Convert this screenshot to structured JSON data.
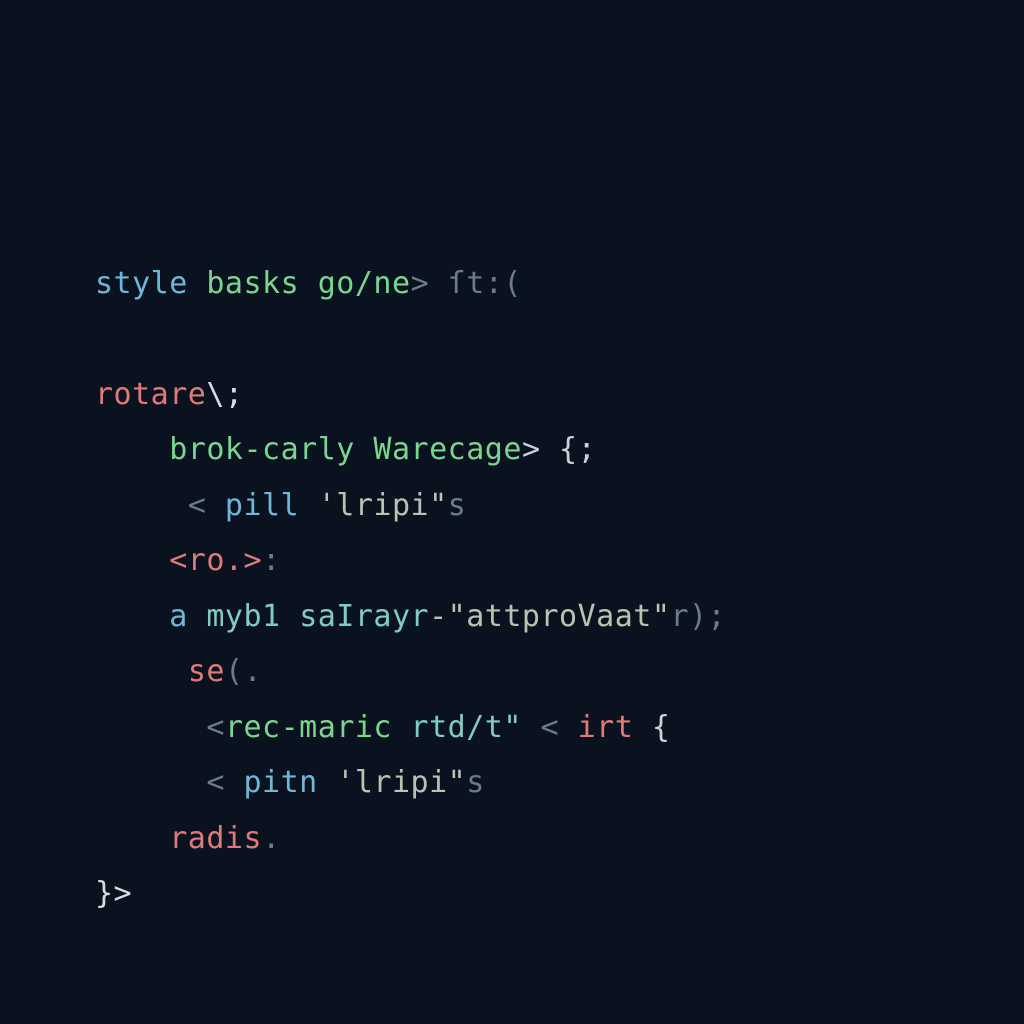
{
  "code": {
    "l1": {
      "a": "style",
      "b": " basks",
      "c": " go/ne",
      "d": "> ſt:(",
      "e": ""
    },
    "l2": "",
    "l3": {
      "a": "rotare",
      "b": "\\;",
      "c": ""
    },
    "l4": {
      "pad": "    ",
      "a": "brok-carly",
      "b": " Warecage",
      "c": "> {;",
      "d": ""
    },
    "l5": {
      "pad": "     ",
      "a": "<",
      "b": " pill ",
      "c": "'lripi\"",
      "d": "s"
    },
    "l6": {
      "pad": "    ",
      "a": "<ro.>",
      "b": ":"
    },
    "l7": {
      "pad": "    ",
      "a": "a",
      "b": " myb1 ",
      "c": "saIrayr",
      "d": "-\"attproVaat\"",
      "e": "r);"
    },
    "l8": {
      "pad": "     ",
      "a": "se",
      "b": "(."
    },
    "l9": {
      "pad": "      ",
      "a": "<",
      "b": "rec-maric",
      "c": " rtd/t\"",
      "d": " <",
      "e": " irt",
      "f": " {"
    },
    "l10": {
      "pad": "      ",
      "a": "<",
      "b": " pitn ",
      "c": "'lripi\"",
      "d": "s"
    },
    "l11": {
      "pad": "    ",
      "a": "radis",
      "b": "."
    },
    "l12": {
      "a": "}>"
    }
  }
}
